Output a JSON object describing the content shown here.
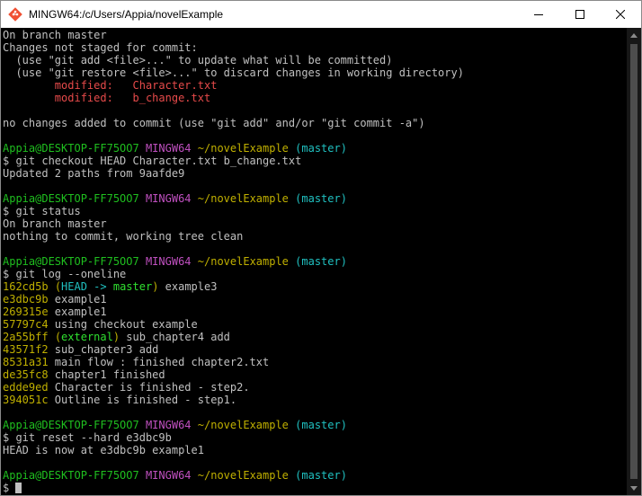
{
  "window": {
    "title": "MINGW64:/c/Users/Appia/novelExample"
  },
  "colors": {
    "default": "#c0c0c0",
    "red": "#e64a4a",
    "green": "#1fbf1f",
    "purple": "#c050c0",
    "yellow": "#c0b000",
    "cyan": "#20c0c0",
    "bright_green": "#30e030"
  },
  "terminal": {
    "lines": [
      [
        {
          "t": "On branch master",
          "c": "default"
        }
      ],
      [
        {
          "t": "Changes not staged for commit:",
          "c": "default"
        }
      ],
      [
        {
          "t": "  (use \"git add <file>...\" to update what will be committed)",
          "c": "default"
        }
      ],
      [
        {
          "t": "  (use \"git restore <file>...\" to discard changes in working directory)",
          "c": "default"
        }
      ],
      [
        {
          "t": "        modified:   Character.txt",
          "c": "red"
        }
      ],
      [
        {
          "t": "        modified:   b_change.txt",
          "c": "red"
        }
      ],
      [
        {
          "t": "",
          "c": "default"
        }
      ],
      [
        {
          "t": "no changes added to commit (use \"git add\" and/or \"git commit -a\")",
          "c": "default"
        }
      ],
      [
        {
          "t": "",
          "c": "default"
        }
      ],
      [
        {
          "t": "Appia@DESKTOP-FF75OO7",
          "c": "green"
        },
        {
          "t": " ",
          "c": "default"
        },
        {
          "t": "MINGW64",
          "c": "purple"
        },
        {
          "t": " ",
          "c": "default"
        },
        {
          "t": "~/novelExample",
          "c": "yellow"
        },
        {
          "t": " ",
          "c": "default"
        },
        {
          "t": "(master)",
          "c": "cyan"
        }
      ],
      [
        {
          "t": "$ git checkout HEAD Character.txt b_change.txt",
          "c": "default"
        }
      ],
      [
        {
          "t": "Updated 2 paths from 9aafde9",
          "c": "default"
        }
      ],
      [
        {
          "t": "",
          "c": "default"
        }
      ],
      [
        {
          "t": "Appia@DESKTOP-FF75OO7",
          "c": "green"
        },
        {
          "t": " ",
          "c": "default"
        },
        {
          "t": "MINGW64",
          "c": "purple"
        },
        {
          "t": " ",
          "c": "default"
        },
        {
          "t": "~/novelExample",
          "c": "yellow"
        },
        {
          "t": " ",
          "c": "default"
        },
        {
          "t": "(master)",
          "c": "cyan"
        }
      ],
      [
        {
          "t": "$ git status",
          "c": "default"
        }
      ],
      [
        {
          "t": "On branch master",
          "c": "default"
        }
      ],
      [
        {
          "t": "nothing to commit, working tree clean",
          "c": "default"
        }
      ],
      [
        {
          "t": "",
          "c": "default"
        }
      ],
      [
        {
          "t": "Appia@DESKTOP-FF75OO7",
          "c": "green"
        },
        {
          "t": " ",
          "c": "default"
        },
        {
          "t": "MINGW64",
          "c": "purple"
        },
        {
          "t": " ",
          "c": "default"
        },
        {
          "t": "~/novelExample",
          "c": "yellow"
        },
        {
          "t": " ",
          "c": "default"
        },
        {
          "t": "(master)",
          "c": "cyan"
        }
      ],
      [
        {
          "t": "$ git log --oneline",
          "c": "default"
        }
      ],
      [
        {
          "t": "162cd5b",
          "c": "yellow"
        },
        {
          "t": " ",
          "c": "default"
        },
        {
          "t": "(",
          "c": "yellow"
        },
        {
          "t": "HEAD -> ",
          "c": "cyan"
        },
        {
          "t": "master",
          "c": "bright_green"
        },
        {
          "t": ")",
          "c": "yellow"
        },
        {
          "t": " example3",
          "c": "default"
        }
      ],
      [
        {
          "t": "e3dbc9b",
          "c": "yellow"
        },
        {
          "t": " example1",
          "c": "default"
        }
      ],
      [
        {
          "t": "269315e",
          "c": "yellow"
        },
        {
          "t": " example1",
          "c": "default"
        }
      ],
      [
        {
          "t": "57797c4",
          "c": "yellow"
        },
        {
          "t": " using checkout example",
          "c": "default"
        }
      ],
      [
        {
          "t": "2a55bff",
          "c": "yellow"
        },
        {
          "t": " ",
          "c": "default"
        },
        {
          "t": "(",
          "c": "yellow"
        },
        {
          "t": "external",
          "c": "bright_green"
        },
        {
          "t": ")",
          "c": "yellow"
        },
        {
          "t": " sub_chapter4 add",
          "c": "default"
        }
      ],
      [
        {
          "t": "43571f2",
          "c": "yellow"
        },
        {
          "t": " sub_chapter3 add",
          "c": "default"
        }
      ],
      [
        {
          "t": "8531a31",
          "c": "yellow"
        },
        {
          "t": " main flow : finished chapter2.txt",
          "c": "default"
        }
      ],
      [
        {
          "t": "de35fc8",
          "c": "yellow"
        },
        {
          "t": " chapter1 finished",
          "c": "default"
        }
      ],
      [
        {
          "t": "edde9ed",
          "c": "yellow"
        },
        {
          "t": " Character is finished - step2.",
          "c": "default"
        }
      ],
      [
        {
          "t": "394051c",
          "c": "yellow"
        },
        {
          "t": " Outline is finished - step1.",
          "c": "default"
        }
      ],
      [
        {
          "t": "",
          "c": "default"
        }
      ],
      [
        {
          "t": "Appia@DESKTOP-FF75OO7",
          "c": "green"
        },
        {
          "t": " ",
          "c": "default"
        },
        {
          "t": "MINGW64",
          "c": "purple"
        },
        {
          "t": " ",
          "c": "default"
        },
        {
          "t": "~/novelExample",
          "c": "yellow"
        },
        {
          "t": " ",
          "c": "default"
        },
        {
          "t": "(master)",
          "c": "cyan"
        }
      ],
      [
        {
          "t": "$ git reset --hard e3dbc9b",
          "c": "default"
        }
      ],
      [
        {
          "t": "HEAD is now at e3dbc9b example1",
          "c": "default"
        }
      ],
      [
        {
          "t": "",
          "c": "default"
        }
      ],
      [
        {
          "t": "Appia@DESKTOP-FF75OO7",
          "c": "green"
        },
        {
          "t": " ",
          "c": "default"
        },
        {
          "t": "MINGW64",
          "c": "purple"
        },
        {
          "t": " ",
          "c": "default"
        },
        {
          "t": "~/novelExample",
          "c": "yellow"
        },
        {
          "t": " ",
          "c": "default"
        },
        {
          "t": "(master)",
          "c": "cyan"
        }
      ],
      [
        {
          "t": "$ ",
          "c": "default"
        }
      ]
    ]
  },
  "icons": {
    "app": "git-bash-icon",
    "minimize": "minimize-icon",
    "maximize": "maximize-icon",
    "close": "close-icon",
    "scroll_up": "scroll-up-arrow-icon",
    "scroll_down": "scroll-down-arrow-icon"
  }
}
